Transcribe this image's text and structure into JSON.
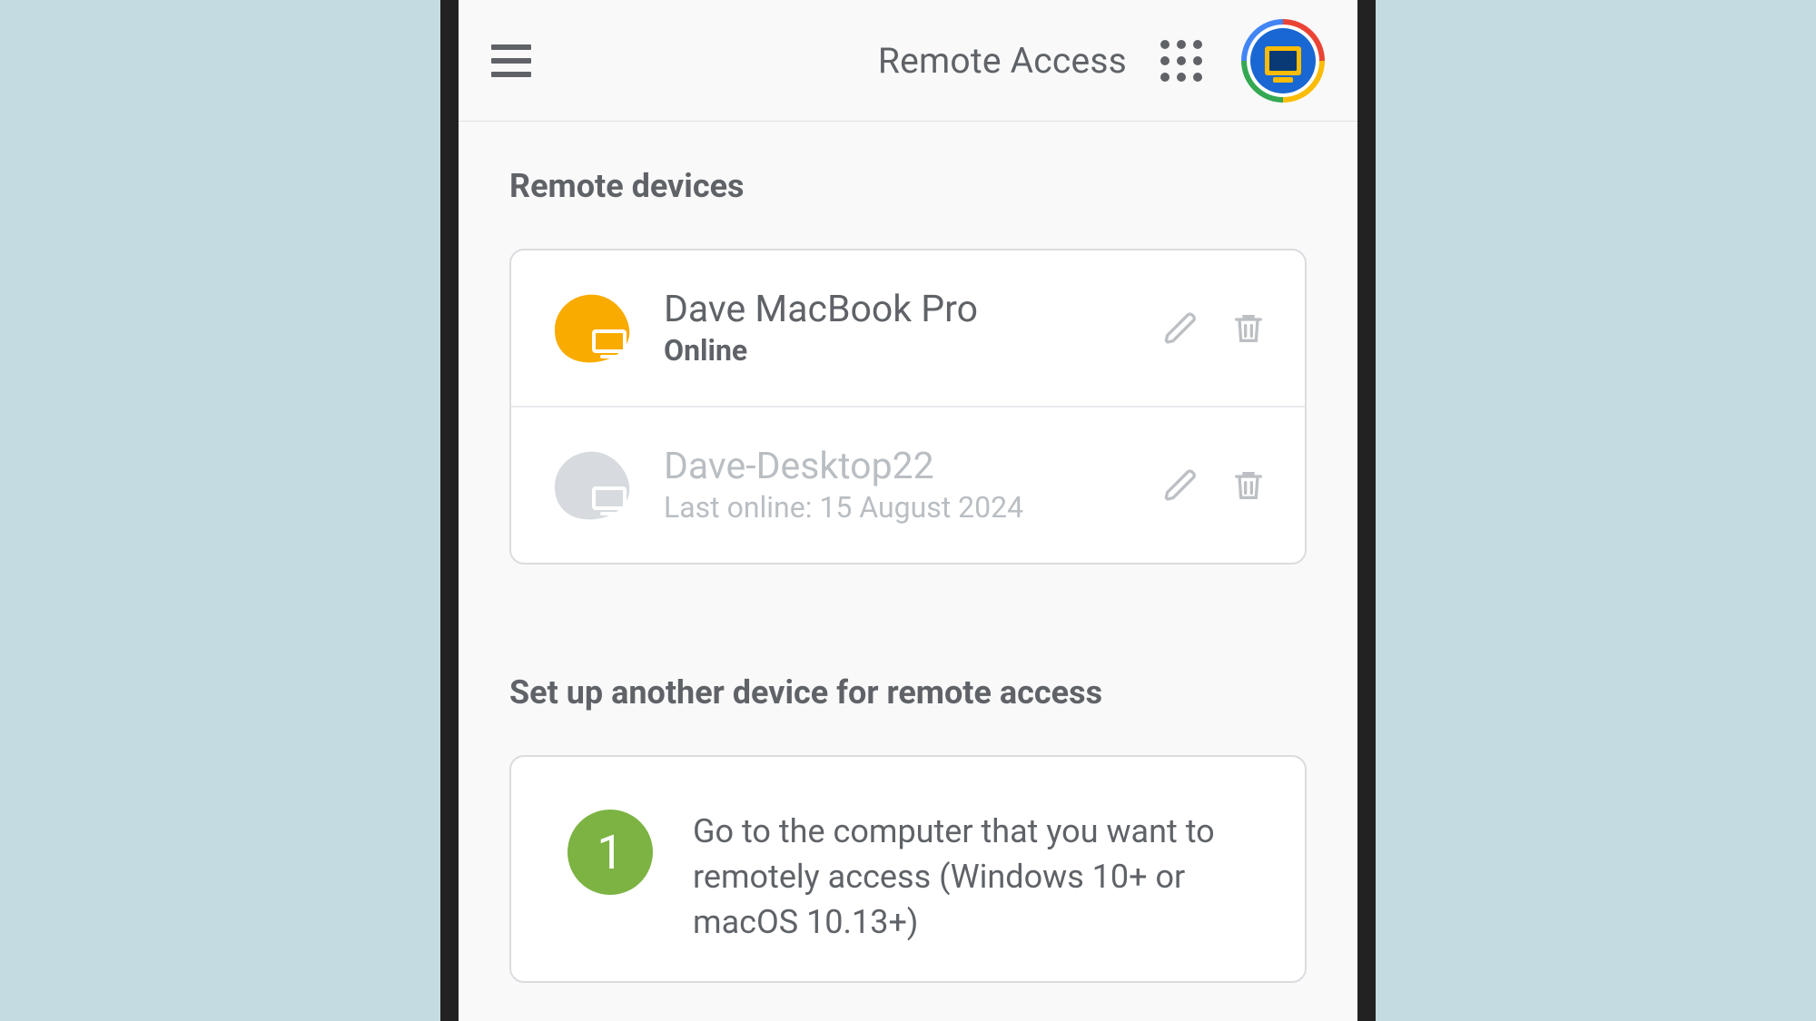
{
  "header": {
    "title": "Remote Access"
  },
  "sections": {
    "devices_title": "Remote devices",
    "setup_title": "Set up another device for remote access"
  },
  "devices": [
    {
      "name": "Dave MacBook Pro",
      "status": "Online",
      "online": true,
      "blob_color": "#f9ab00"
    },
    {
      "name": "Dave-Desktop22",
      "status": "Last online: 15 August 2024",
      "online": false,
      "blob_color": "#cfd3d7"
    }
  ],
  "setup_steps": [
    {
      "number": "1",
      "text": "Go to the computer that you want to remotely access (Windows 10+ or macOS 10.13+)"
    }
  ]
}
